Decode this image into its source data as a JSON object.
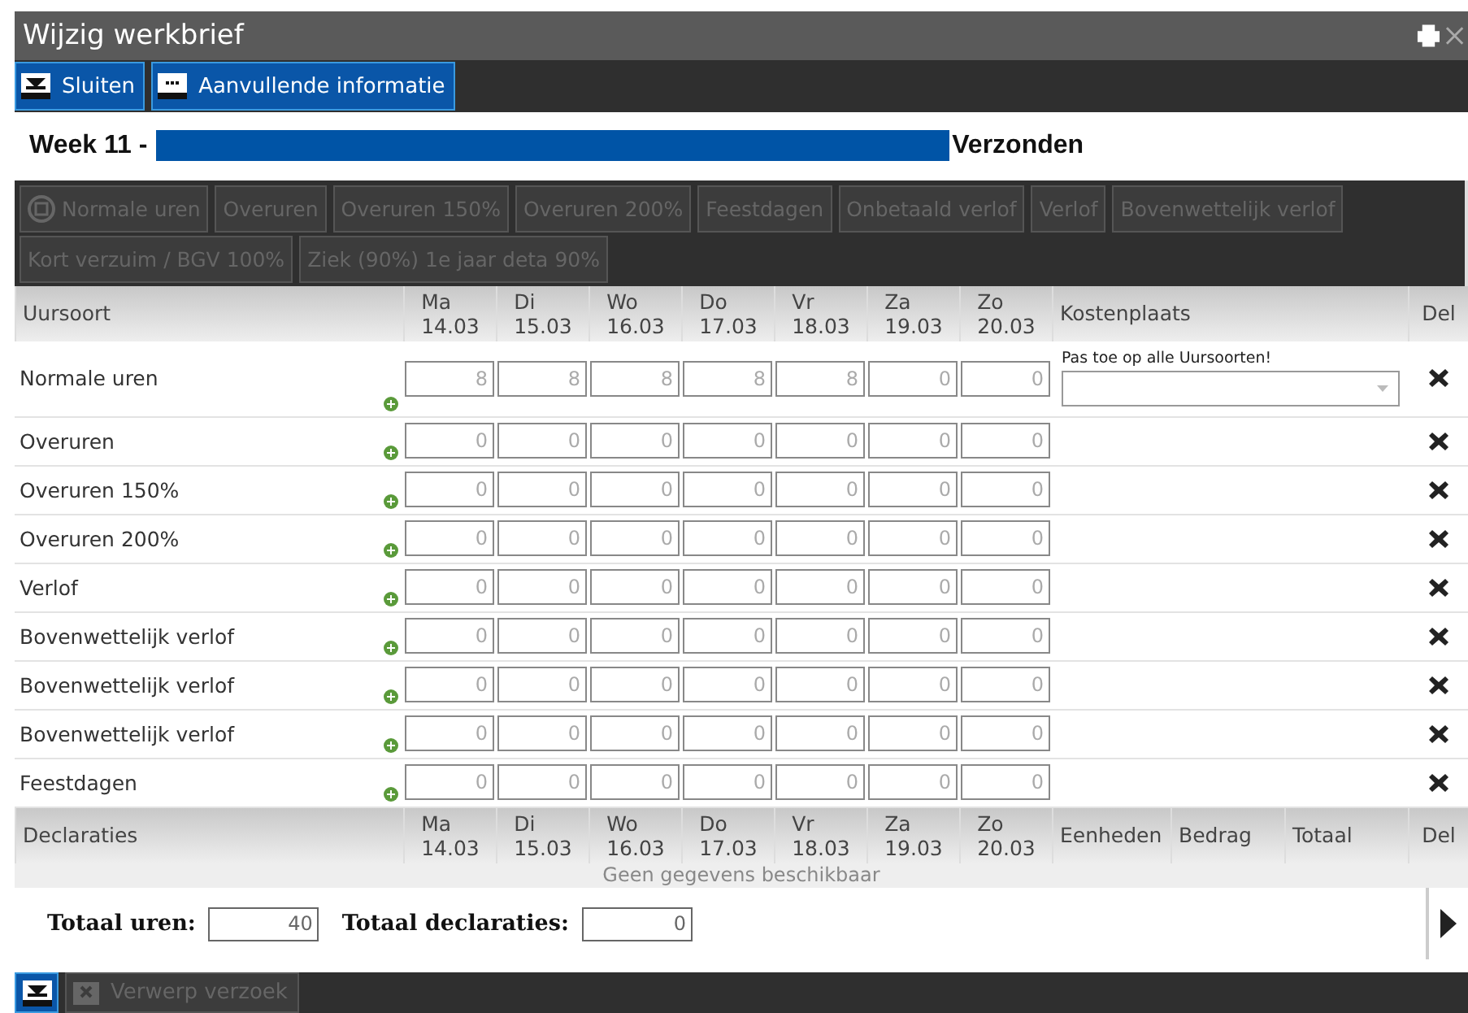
{
  "window": {
    "title": "Wijzig werkbrief"
  },
  "toolbar": [
    {
      "label": "Sluiten",
      "kind": "close"
    },
    {
      "label": "Aanvullende informatie",
      "kind": "info"
    }
  ],
  "header": {
    "week": "Week 11 -",
    "status": "Verzonden"
  },
  "hour_types": [
    {
      "label": "Normale uren",
      "disabled": true,
      "icon": true
    },
    {
      "label": "Overuren",
      "disabled": true
    },
    {
      "label": "Overuren 150%",
      "disabled": true
    },
    {
      "label": "Overuren 200%",
      "disabled": true
    },
    {
      "label": "Feestdagen",
      "disabled": true
    },
    {
      "label": "Onbetaald verlof",
      "disabled": true
    },
    {
      "label": "Verlof",
      "disabled": true
    },
    {
      "label": "Bovenwettelijk verlof",
      "disabled": true
    },
    {
      "label": "Kort verzuim / BGV 100%",
      "disabled": true
    },
    {
      "label": "Ziek (90%) 1e jaar deta 90%",
      "disabled": true
    }
  ],
  "hours_table": {
    "columns": [
      "Uursoort",
      "Kostenplaats",
      "Del"
    ],
    "days": [
      {
        "day": "Ma",
        "date": "14.03"
      },
      {
        "day": "Di",
        "date": "15.03"
      },
      {
        "day": "Wo",
        "date": "16.03"
      },
      {
        "day": "Do",
        "date": "17.03"
      },
      {
        "day": "Vr",
        "date": "18.03"
      },
      {
        "day": "Za",
        "date": "19.03"
      },
      {
        "day": "Zo",
        "date": "20.03"
      }
    ],
    "rows": [
      {
        "name": "Normale uren",
        "values": [
          "8",
          "8",
          "8",
          "8",
          "8",
          "0",
          "0"
        ],
        "cost_hint": "Pas toe op alle Uursoorten!"
      },
      {
        "name": "Overuren",
        "values": [
          "0",
          "0",
          "0",
          "0",
          "0",
          "0",
          "0"
        ]
      },
      {
        "name": "Overuren 150%",
        "values": [
          "0",
          "0",
          "0",
          "0",
          "0",
          "0",
          "0"
        ]
      },
      {
        "name": "Overuren 200%",
        "values": [
          "0",
          "0",
          "0",
          "0",
          "0",
          "0",
          "0"
        ]
      },
      {
        "name": "Verlof",
        "values": [
          "0",
          "0",
          "0",
          "0",
          "0",
          "0",
          "0"
        ]
      },
      {
        "name": "Bovenwettelijk verlof",
        "values": [
          "0",
          "0",
          "0",
          "0",
          "0",
          "0",
          "0"
        ]
      },
      {
        "name": "Bovenwettelijk verlof",
        "values": [
          "0",
          "0",
          "0",
          "0",
          "0",
          "0",
          "0"
        ]
      },
      {
        "name": "Bovenwettelijk verlof",
        "values": [
          "0",
          "0",
          "0",
          "0",
          "0",
          "0",
          "0"
        ]
      },
      {
        "name": "Feestdagen",
        "values": [
          "0",
          "0",
          "0",
          "0",
          "0",
          "0",
          "0"
        ]
      }
    ]
  },
  "declarations_table": {
    "columns": [
      "Declaraties",
      "Eenheden",
      "Bedrag",
      "Totaal",
      "Del"
    ],
    "days": [
      {
        "day": "Ma",
        "date": "14.03"
      },
      {
        "day": "Di",
        "date": "15.03"
      },
      {
        "day": "Wo",
        "date": "16.03"
      },
      {
        "day": "Do",
        "date": "17.03"
      },
      {
        "day": "Vr",
        "date": "18.03"
      },
      {
        "day": "Za",
        "date": "19.03"
      },
      {
        "day": "Zo",
        "date": "20.03"
      }
    ],
    "empty_text": "Geen gegevens beschikbaar"
  },
  "totals": [
    {
      "label": "Totaal uren:",
      "value": "40"
    },
    {
      "label": "Totaal declaraties:",
      "value": "0"
    }
  ],
  "footer": [
    {
      "kind": "icon",
      "disabled": false
    },
    {
      "kind": "reject",
      "label": "Verwerp verzoek",
      "disabled": true
    }
  ]
}
